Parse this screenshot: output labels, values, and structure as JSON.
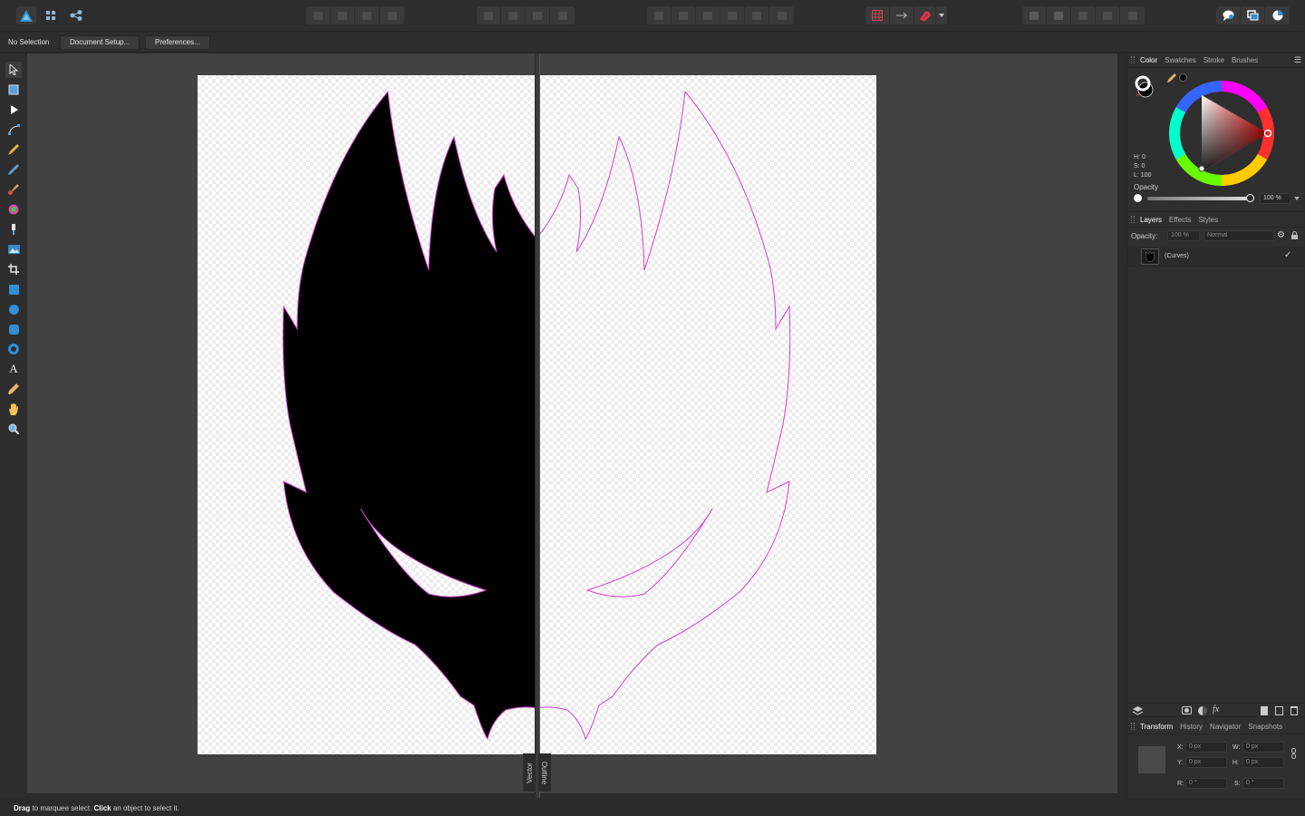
{
  "context_bar": {
    "selection_label": "No Selection",
    "document_setup_label": "Document Setup...",
    "preferences_label": "Preferences..."
  },
  "canvas": {
    "left_view_label": "Vector",
    "right_view_label": "Outline"
  },
  "status": {
    "part1_bold": "Drag",
    "part1": " to marquee select. ",
    "part2_bold": "Click",
    "part2": " an object to select it."
  },
  "color_panel": {
    "tabs": [
      "Color",
      "Swatches",
      "Stroke",
      "Brushes"
    ],
    "h_label": "H: 0",
    "s_label": "S: 0",
    "l_label": "L: 100",
    "opacity_label": "Opacity",
    "opacity_value": "100 %"
  },
  "layers_panel": {
    "tabs": [
      "Layers",
      "Effects",
      "Styles"
    ],
    "opacity_label": "Opacity:",
    "opacity_value": "100 %",
    "blend_mode": "Normal",
    "layer_name": "(Curves)"
  },
  "transform_panel": {
    "tabs": [
      "Transform",
      "History",
      "Navigator",
      "Snapshots"
    ],
    "x_label": "X:",
    "x_value": "0 px",
    "y_label": "Y:",
    "y_value": "0 px",
    "w_label": "W:",
    "w_value": "0 px",
    "h_label": "H:",
    "h_value": "0 px",
    "r_label": "R:",
    "r_value": "0 °",
    "s_label": "S:",
    "s_value": "0 °"
  },
  "colors": {
    "accent": "#2f8fd6",
    "outline": "#d23fd0",
    "snap_red": "#e2344c"
  }
}
